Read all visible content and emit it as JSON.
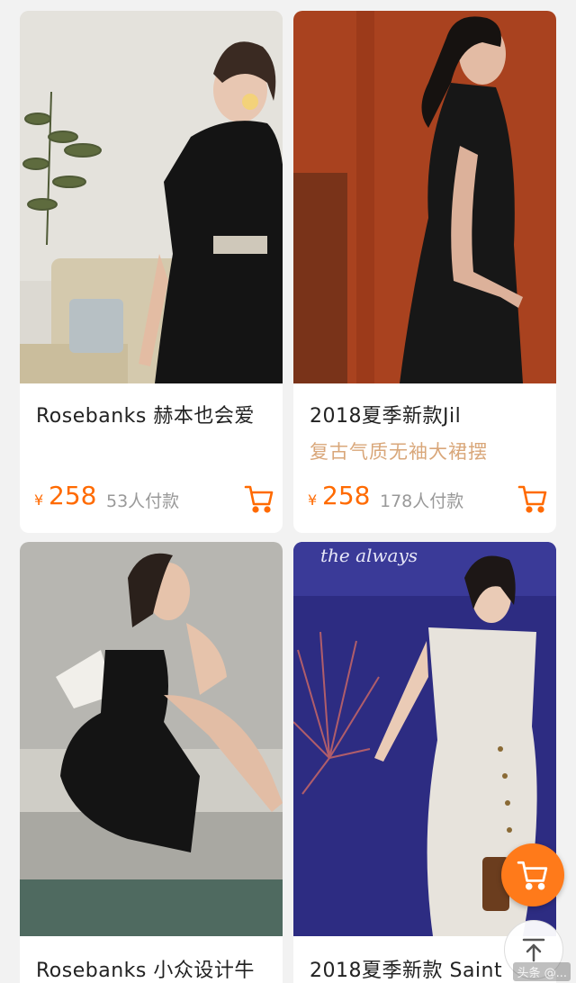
{
  "products": [
    {
      "title": "Rosebanks 赫本也会爱",
      "subtitle": "",
      "currency": "¥",
      "price": "258",
      "paid": "53人付款"
    },
    {
      "title": "2018夏季新款Jil",
      "subtitle": "复古气质无袖大裙摆",
      "currency": "¥",
      "price": "258",
      "paid": "178人付款"
    },
    {
      "title": "Rosebanks 小众设计牛",
      "subtitle": "",
      "currency": "",
      "price": "",
      "paid": ""
    },
    {
      "title": "2018夏季新款 Saint",
      "subtitle": "",
      "currency": "",
      "price": "",
      "paid": ""
    }
  ],
  "photo4_sign_text": "the always",
  "watermark": "头条 @...",
  "colors": {
    "accent": "#ff6a00",
    "subtitle": "#d9a77a",
    "fab": "#ff7a1a"
  },
  "icons": {
    "cart": "cart-icon",
    "back_to_top": "arrow-up-icon"
  }
}
